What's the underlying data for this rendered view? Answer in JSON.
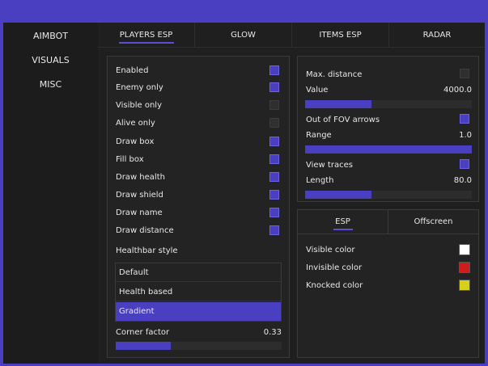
{
  "sidebar": {
    "items": [
      {
        "label": "AIMBOT"
      },
      {
        "label": "VISUALS"
      },
      {
        "label": "MISC"
      }
    ]
  },
  "tabs": [
    {
      "label": "PLAYERS ESP"
    },
    {
      "label": "GLOW"
    },
    {
      "label": "ITEMS ESP"
    },
    {
      "label": "RADAR"
    }
  ],
  "left_panel": {
    "toggles": [
      {
        "label": "Enabled",
        "checked": true
      },
      {
        "label": "Enemy only",
        "checked": true
      },
      {
        "label": "Visible only",
        "checked": false
      },
      {
        "label": "Alive only",
        "checked": false
      },
      {
        "label": "Draw box",
        "checked": true
      },
      {
        "label": "Fill box",
        "checked": true
      },
      {
        "label": "Draw health",
        "checked": true
      },
      {
        "label": "Draw shield",
        "checked": true
      },
      {
        "label": "Draw name",
        "checked": true
      },
      {
        "label": "Draw distance",
        "checked": true
      }
    ],
    "healthbar_label": "Healthbar style",
    "healthbar_options": [
      "Default",
      "Health based",
      "Gradient"
    ],
    "healthbar_selected": "Gradient",
    "corner_factor_label": "Corner factor",
    "corner_factor_value": "0.33",
    "corner_factor_fraction": 0.33
  },
  "right_top_panel": {
    "max_distance_label": "Max. distance",
    "max_distance_checked": false,
    "value_label": "Value",
    "value_value": "4000.0",
    "value_fraction": 0.4,
    "fov_arrows_label": "Out of FOV arrows",
    "fov_arrows_checked": true,
    "range_label": "Range",
    "range_value": "1.0",
    "range_fraction": 1.0,
    "view_traces_label": "View traces",
    "view_traces_checked": true,
    "length_label": "Length",
    "length_value": "80.0",
    "length_fraction": 0.4
  },
  "right_bottom_panel": {
    "subtabs": [
      {
        "label": "ESP"
      },
      {
        "label": "Offscreen"
      }
    ],
    "colors": [
      {
        "label": "Visible color",
        "color": "#ffffff"
      },
      {
        "label": "Invisible color",
        "color": "#d01c1c"
      },
      {
        "label": "Knocked color",
        "color": "#d6d01c"
      }
    ]
  },
  "theme": {
    "accent": "#4a3fc1",
    "background": "#1c1c1c"
  }
}
